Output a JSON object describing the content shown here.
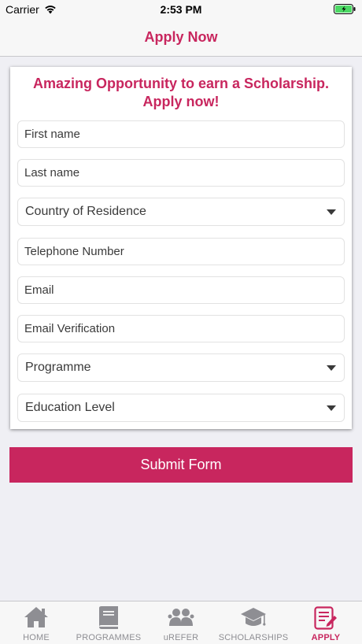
{
  "status_bar": {
    "carrier": "Carrier",
    "time": "2:53 PM"
  },
  "nav": {
    "title": "Apply Now"
  },
  "form": {
    "headline": "Amazing Opportunity to earn a Scholarship. Apply now!",
    "first_name_placeholder": "First name",
    "last_name_placeholder": "Last name",
    "country_label": "Country of Residence",
    "telephone_placeholder": "Telephone Number",
    "email_placeholder": "Email",
    "email_verification_placeholder": "Email Verification",
    "programme_label": "Programme",
    "education_label": "Education Level",
    "submit_label": "Submit Form"
  },
  "tabs": [
    {
      "label": "HOME",
      "icon": "home-icon"
    },
    {
      "label": "PROGRAMMES",
      "icon": "book-icon"
    },
    {
      "label": "uREFER",
      "icon": "people-icon"
    },
    {
      "label": "SCHOLARSHIPS",
      "icon": "graduation-cap-icon"
    },
    {
      "label": "APPLY",
      "icon": "form-edit-icon"
    }
  ],
  "colors": {
    "accent": "#c8265e",
    "inactive_tab": "#8e8e93",
    "battery": "#4cd964"
  }
}
